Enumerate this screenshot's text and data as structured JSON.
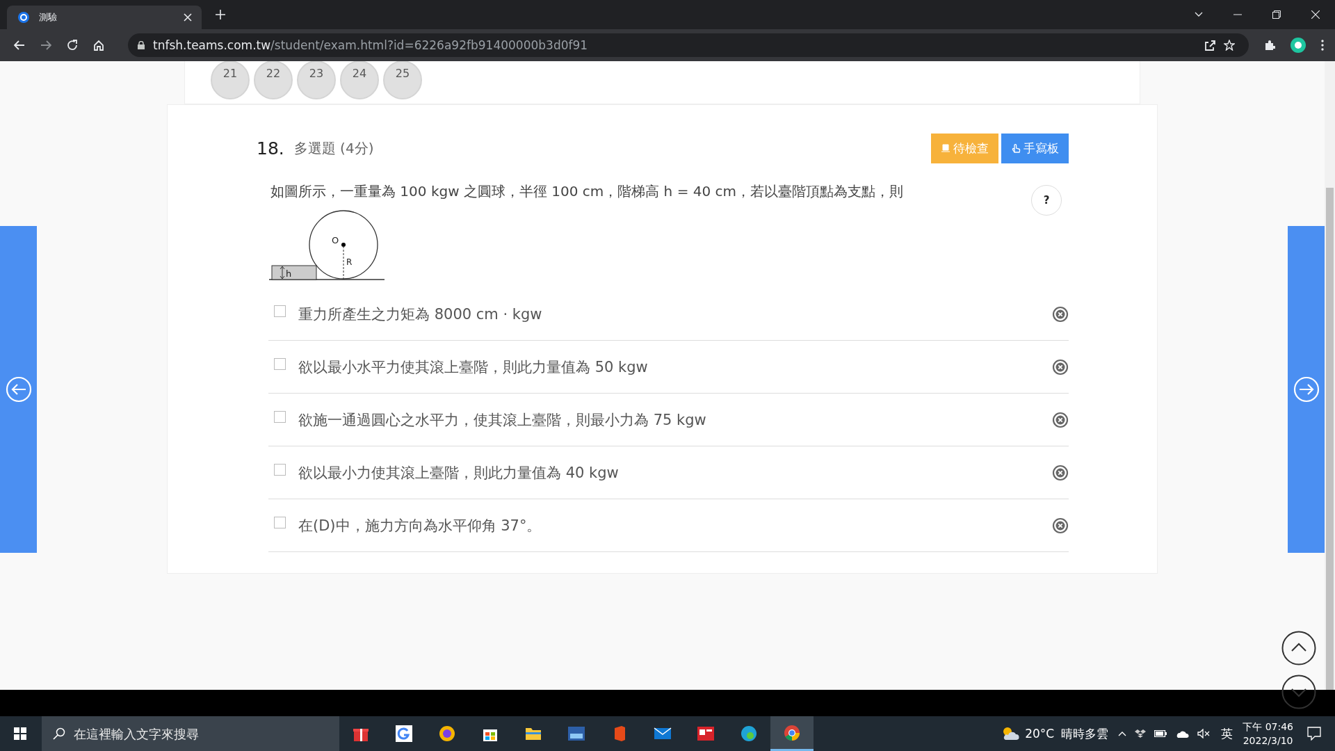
{
  "browser": {
    "tab_title": "測驗",
    "url_host": "tnfsh.teams.com.tw",
    "url_path": "/student/exam.html?id=6226a92fb91400000b3d0f91"
  },
  "question_nav": [
    {
      "label": "21"
    },
    {
      "label": "22"
    },
    {
      "label": "23"
    },
    {
      "label": "24"
    },
    {
      "label": "25"
    }
  ],
  "question": {
    "number": "18.",
    "type": "多選題 (4分)",
    "buttons": [
      {
        "label": "待檢查",
        "kind": "review"
      },
      {
        "label": "手寫板",
        "kind": "handwriting"
      }
    ],
    "help": "?",
    "text": "如圖所示，一重量為 100 kgw 之圓球，半徑 100 cm，階梯高 h = 40 cm，若以臺階頂點為支點，則",
    "figure_labels": {
      "center": "O",
      "radius": "R",
      "height": "h"
    },
    "options": [
      {
        "text": "重力所產生之力矩為 8000 cm · kgw",
        "checked": false
      },
      {
        "text": "欲以最小水平力使其滾上臺階，則此力量值為 50 kgw",
        "checked": false
      },
      {
        "text": "欲施一通過圓心之水平力，使其滾上臺階，則最小力為 75 kgw",
        "checked": false
      },
      {
        "text": "欲以最小力使其滾上臺階，則此力量值為 40 kgw",
        "checked": false
      },
      {
        "text": "在(D)中，施力方向為水平仰角 37°。",
        "checked": false
      }
    ]
  },
  "taskbar": {
    "search_placeholder": "在這裡輸入文字來搜尋",
    "temperature": "20°C",
    "weather_text": "晴時多雲",
    "ime": "英",
    "time": "下午 07:46",
    "date": "2022/3/10"
  }
}
